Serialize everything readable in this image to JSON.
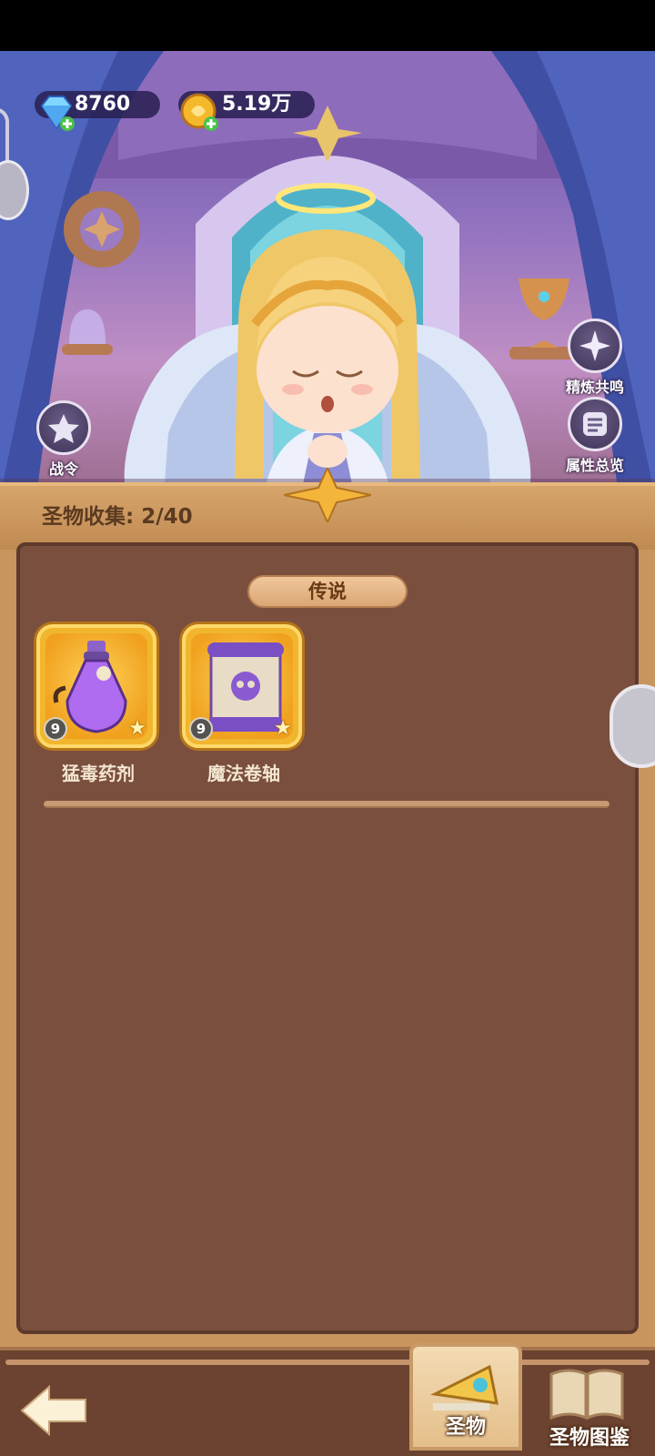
{
  "currency": {
    "gems": "8760",
    "gold": "5.19万"
  },
  "side_buttons": {
    "battle_pass": "战令",
    "refine_resonance": "精炼共鸣",
    "attribute_overview": "属性总览"
  },
  "panel": {
    "collection_label": "圣物收集: 2/40",
    "section_title": "传说",
    "relics": [
      {
        "name": "猛毒药剂",
        "level": "9",
        "icon": "poison-potion-icon"
      },
      {
        "name": "魔法卷轴",
        "level": "9",
        "icon": "magic-scroll-icon"
      }
    ]
  },
  "bottom_tabs": {
    "relics": "圣物",
    "relic_codex": "圣物图鉴"
  },
  "colors": {
    "panel_bg": "#7a4f3e",
    "frame_gold": "#f1b62e",
    "accent": "#c8955e"
  }
}
